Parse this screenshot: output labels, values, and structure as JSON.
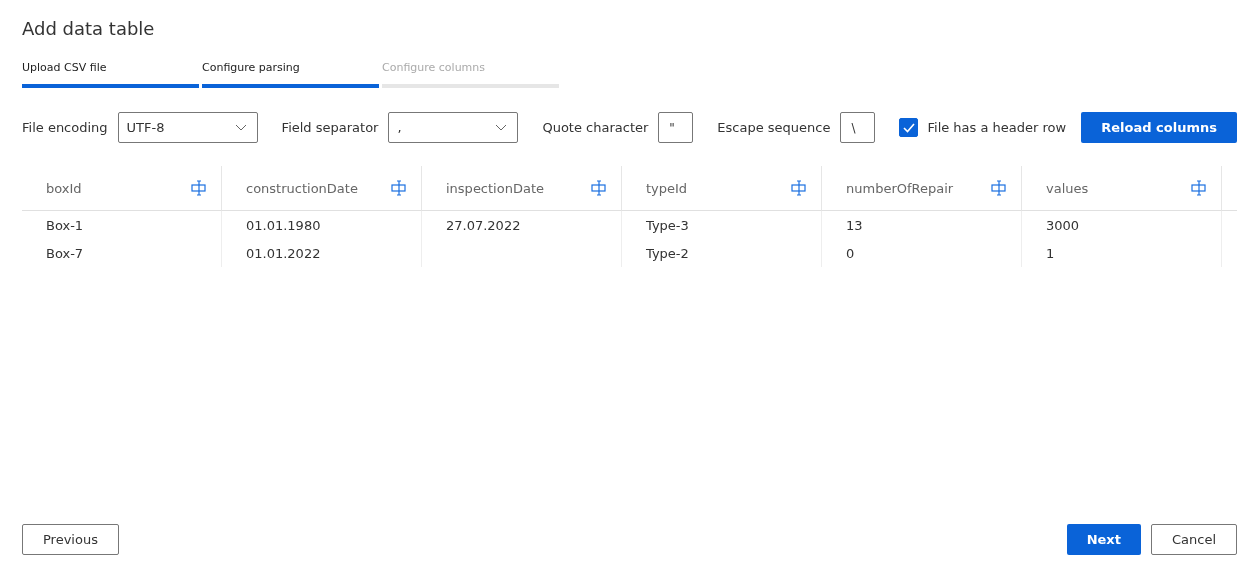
{
  "title": "Add data table",
  "steps": [
    {
      "label": "Upload CSV file",
      "done": true
    },
    {
      "label": "Configure parsing",
      "done": true
    },
    {
      "label": "Configure columns",
      "done": false
    }
  ],
  "form": {
    "encoding_label": "File encoding",
    "encoding_value": "UTF-8",
    "separator_label": "Field separator",
    "separator_value": ",",
    "quote_label": "Quote character",
    "quote_value": "\"",
    "escape_label": "Escape sequence",
    "escape_value": "\\",
    "header_label": "File has a header row",
    "header_checked": true,
    "reload_button": "Reload columns"
  },
  "table": {
    "columns": [
      "boxId",
      "constructionDate",
      "inspectionDate",
      "typeId",
      "numberOfRepair",
      "values"
    ],
    "rows": [
      [
        "Box-1",
        "01.01.1980",
        "27.07.2022",
        "Type-3",
        "13",
        "3000"
      ],
      [
        "Box-7",
        "01.01.2022",
        "",
        "Type-2",
        "0",
        "1"
      ]
    ]
  },
  "footer": {
    "previous": "Previous",
    "next": "Next",
    "cancel": "Cancel"
  }
}
